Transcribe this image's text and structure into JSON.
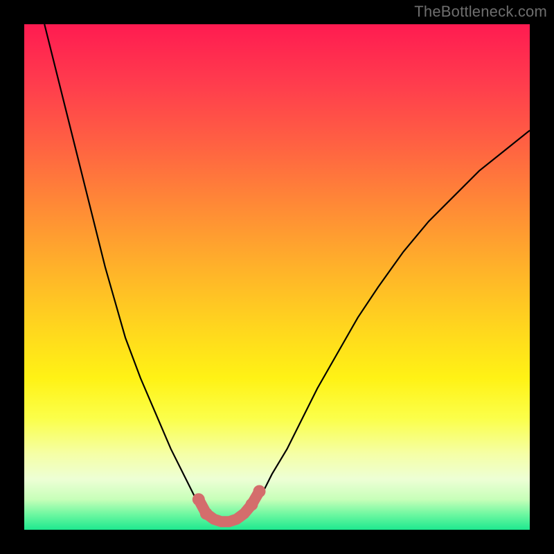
{
  "watermark": "TheBottleneck.com",
  "chart_data": {
    "type": "line",
    "title": "",
    "xlabel": "",
    "ylabel": "",
    "xlim": [
      0,
      100
    ],
    "ylim": [
      0,
      100
    ],
    "grid": false,
    "legend": false,
    "series": [
      {
        "name": "bottleneck-curve",
        "x": [
          4,
          6,
          8,
          10,
          12,
          14,
          16,
          18,
          20,
          23,
          26,
          29,
          32,
          34,
          36,
          37.5,
          39,
          41,
          43,
          45,
          47,
          49,
          52,
          55,
          58,
          62,
          66,
          70,
          75,
          80,
          85,
          90,
          95,
          100
        ],
        "y": [
          100,
          92,
          84,
          76,
          68,
          60,
          52,
          45,
          38,
          30,
          23,
          16,
          10,
          6,
          3,
          2,
          1.5,
          1.5,
          2,
          4,
          7,
          11,
          16,
          22,
          28,
          35,
          42,
          48,
          55,
          61,
          66,
          71,
          75,
          79
        ]
      }
    ],
    "highlight": {
      "name": "bottom-segment",
      "x": [
        34.5,
        36,
        37.5,
        39,
        40.5,
        42,
        43.5,
        45,
        46.5
      ],
      "y": [
        6,
        3.2,
        2.1,
        1.6,
        1.6,
        2.1,
        3.2,
        5,
        7.6
      ]
    },
    "highlight_dots": {
      "x": [
        34.5,
        36,
        45,
        46.5
      ],
      "y": [
        6,
        3.2,
        5,
        7.6
      ]
    },
    "background": {
      "type": "vertical-gradient",
      "stops": [
        {
          "pos": 0,
          "color": "#ff1b51"
        },
        {
          "pos": 0.5,
          "color": "#ffb12a"
        },
        {
          "pos": 0.75,
          "color": "#fff215"
        },
        {
          "pos": 1.0,
          "color": "#1ee88f"
        }
      ]
    }
  }
}
